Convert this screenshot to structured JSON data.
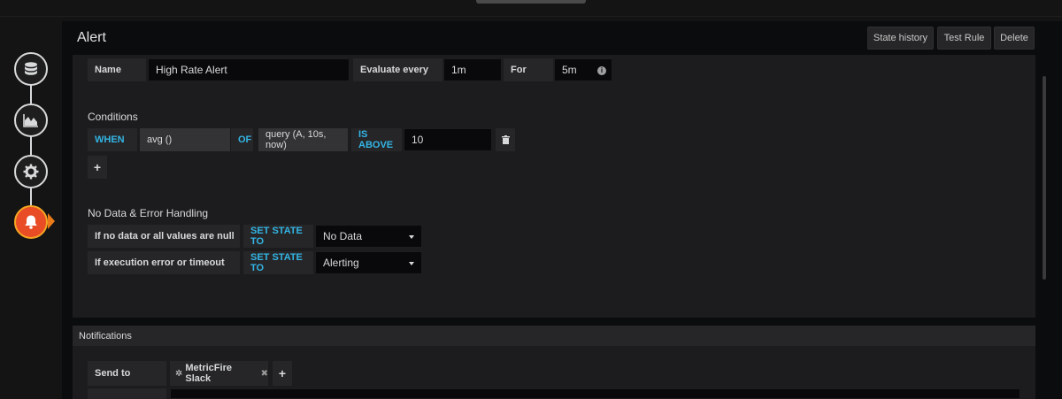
{
  "panel": {
    "title": "Alert",
    "buttons": {
      "state_history": "State history",
      "test_rule": "Test Rule",
      "delete": "Delete"
    }
  },
  "rule": {
    "name_label": "Name",
    "name_value": "High Rate Alert",
    "evaluate_label": "Evaluate every",
    "evaluate_value": "1m",
    "for_label": "For",
    "for_value": "5m"
  },
  "conditions": {
    "heading": "Conditions",
    "when": "WHEN",
    "reducer": "avg ()",
    "of": "OF",
    "query": "query (A, 10s, now)",
    "evaluator": "IS ABOVE",
    "threshold": "10",
    "add_label": "+"
  },
  "no_data": {
    "heading": "No Data & Error Handling",
    "rows": [
      {
        "label": "If no data or all values are null",
        "action": "SET STATE TO",
        "value": "No Data"
      },
      {
        "label": "If execution error or timeout",
        "action": "SET STATE TO",
        "value": "Alerting"
      }
    ]
  },
  "notifications": {
    "heading": "Notifications",
    "send_to_label": "Send to",
    "channel": "MetricFire Slack",
    "add_label": "+"
  },
  "icons": {
    "step1": "database-icon",
    "step2": "chart-icon",
    "step3": "gear-icon",
    "step4": "bell-icon"
  },
  "colors": {
    "accent": "#33b5e5",
    "active_step": "#e84d25"
  }
}
